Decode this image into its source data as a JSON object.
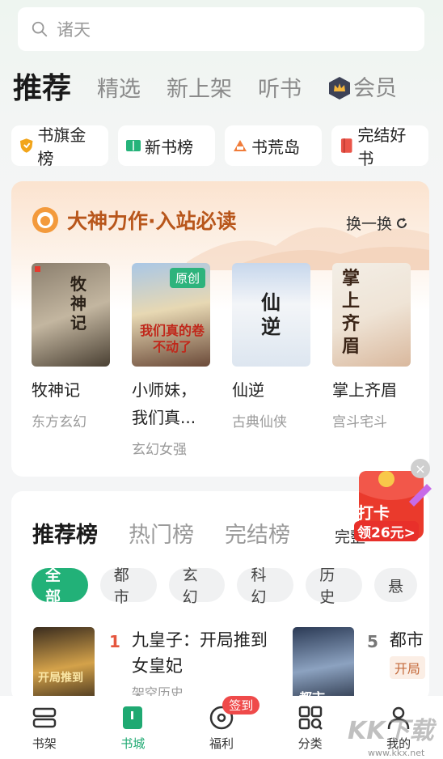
{
  "search": {
    "placeholder": "诸天"
  },
  "top_tabs": [
    {
      "label": "推荐"
    },
    {
      "label": "精选"
    },
    {
      "label": "新上架"
    },
    {
      "label": "听书"
    },
    {
      "label": "会员"
    }
  ],
  "rank_chips": [
    {
      "label": "书旗金榜",
      "icon": "shield-icon",
      "color": "#f2a51a"
    },
    {
      "label": "新书榜",
      "icon": "book-open-icon",
      "color": "#25b37a"
    },
    {
      "label": "书荒岛",
      "icon": "island-icon",
      "color": "#f07c3a"
    },
    {
      "label": "完结好书",
      "icon": "book-icon",
      "color": "#ea5448"
    }
  ],
  "god_section": {
    "title": "大神力作·入站必读",
    "refresh_label": "换一换",
    "books": [
      {
        "title": "牧神记",
        "genre": "东方玄幻",
        "cover_text": "牧神记"
      },
      {
        "title": "小师妹，我们真...",
        "genre": "玄幻女强",
        "cover_text": "我们真的卷不动了",
        "badge": "原创"
      },
      {
        "title": "仙逆",
        "genre": "古典仙侠",
        "cover_text": "仙逆"
      },
      {
        "title": "掌上齐眉",
        "genre": "宫斗宅斗",
        "cover_text": "掌上齐眉"
      }
    ]
  },
  "float_ad": {
    "line1": "打卡",
    "line2": "领26元>",
    "close": "×"
  },
  "rank_section": {
    "tabs": [
      {
        "label": "推荐榜"
      },
      {
        "label": "热门榜"
      },
      {
        "label": "完结榜"
      }
    ],
    "more_label": "完整",
    "categories": [
      "全部",
      "都市",
      "玄幻",
      "科幻",
      "历史",
      "悬"
    ],
    "items": [
      {
        "rank": "1",
        "title": "九皇子：开局推到女皇妃",
        "sub": "架空历史",
        "cover_text": "开局推到"
      },
      {
        "rank": "5",
        "title": "都市",
        "tag": "开局",
        "cover_text": "都市"
      }
    ]
  },
  "bottom_nav": [
    {
      "label": "书架",
      "icon": "bookshelf-icon"
    },
    {
      "label": "书城",
      "icon": "bookstore-icon"
    },
    {
      "label": "福利",
      "icon": "welfare-icon",
      "badge": "签到"
    },
    {
      "label": "分类",
      "icon": "category-icon"
    },
    {
      "label": "我的",
      "icon": "profile-icon"
    }
  ],
  "watermark": {
    "text": "KK下载",
    "url": "www.kkx.net"
  },
  "colors": {
    "accent": "#22b178",
    "god_title": "#b8561b",
    "rank_one": "#e5563e"
  }
}
